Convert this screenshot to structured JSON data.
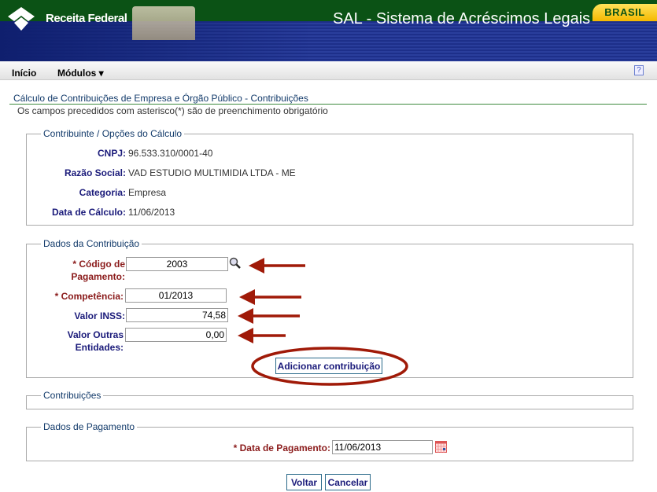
{
  "header": {
    "brand_badge": "BRASIL",
    "logo_text": "Receita Federal",
    "app_title": "SAL - Sistema de Acréscimos Legais"
  },
  "menu": {
    "items": [
      {
        "label": "Início"
      },
      {
        "label": "Módulos ▾"
      }
    ],
    "help": "?"
  },
  "page": {
    "title": "Cálculo de Contribuições de Empresa e Órgão Público - Contribuições",
    "subtitle": "Os campos precedidos com asterisco(*) são de preenchimento obrigatório"
  },
  "contribuinte": {
    "legend": "Contribuinte / Opções do Cálculo",
    "rows": [
      {
        "label": "CNPJ:",
        "value": "96.533.310/0001-40"
      },
      {
        "label": "Razão Social:",
        "value": "VAD ESTUDIO MULTIMIDIA LTDA - ME"
      },
      {
        "label": "Categoria:",
        "value": "Empresa"
      },
      {
        "label": "Data de Cálculo:",
        "value": "11/06/2013"
      }
    ]
  },
  "contribuicao": {
    "legend": "Dados da Contribuição",
    "codigo": {
      "label_1": "* Código de",
      "label_2": "Pagamento:",
      "value": "2003"
    },
    "competencia": {
      "label": "* Competência:",
      "value": "01/2013"
    },
    "valor_inss": {
      "label": "Valor INSS:",
      "value": "74,58"
    },
    "valor_outras": {
      "label_1": "Valor Outras",
      "label_2": "Entidades:",
      "value": "0,00"
    },
    "add_button": "Adicionar contribuição"
  },
  "contribuicoes": {
    "legend": "Contribuições"
  },
  "pagamento": {
    "legend": "Dados de Pagamento",
    "data_label": "* Data de Pagamento:",
    "data_value": "11/06/2013"
  },
  "actions": {
    "voltar": "Voltar",
    "cancelar": "Cancelar"
  },
  "colors": {
    "annotation": "#a01a08",
    "required_label": "#8a1a1a",
    "label": "#1a1a7a",
    "header_green": "#0b5215",
    "header_blue": "#1d2f8a"
  }
}
